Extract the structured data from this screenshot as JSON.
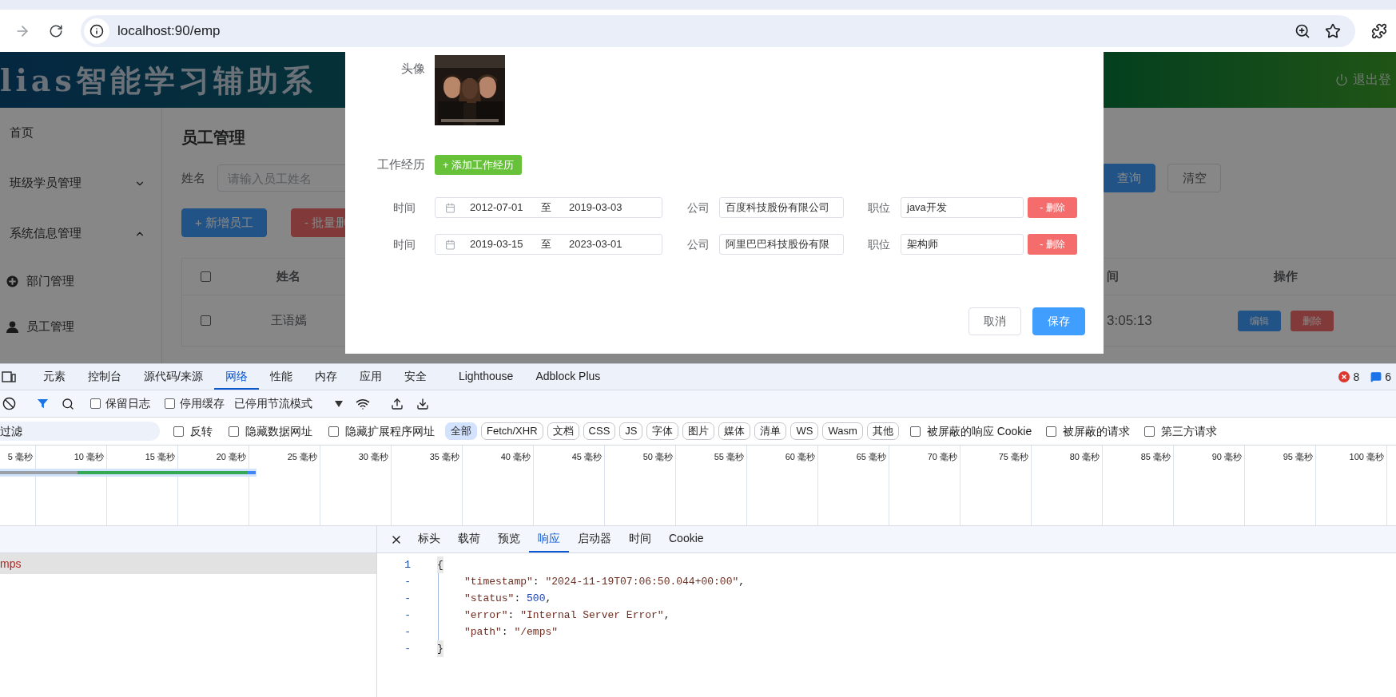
{
  "browser": {
    "url": "localhost:90/emp"
  },
  "app": {
    "header": {
      "title": "lias智能学习辅助系",
      "logout": "退出登"
    },
    "sidebar": {
      "items": [
        {
          "label": "首页",
          "kind": "link"
        },
        {
          "label": "班级学员管理",
          "kind": "group",
          "expanded": false
        },
        {
          "label": "系统信息管理",
          "kind": "group",
          "expanded": true,
          "children": [
            {
              "label": "部门管理"
            },
            {
              "label": "员工管理"
            }
          ]
        }
      ]
    },
    "main": {
      "title": "员工管理",
      "search": {
        "label": "姓名",
        "placeholder": "请输入员工姓名"
      },
      "form_buttons": [
        {
          "label": "查询",
          "kind": "primary"
        },
        {
          "label": "清空",
          "kind": "plain"
        }
      ],
      "actions": [
        {
          "label": "+ 新增员工",
          "kind": "primary"
        },
        {
          "label": "- 批量删",
          "kind": "danger"
        }
      ],
      "table": {
        "select_all": {
          "checked": false
        },
        "columns": [
          "姓名",
          "间",
          "操作"
        ],
        "rows": [
          {
            "checked": false,
            "name": "王语嫣",
            "time": "3:05:13",
            "actions": [
              {
                "label": "编辑",
                "kind": "primary"
              },
              {
                "label": "删除",
                "kind": "danger"
              }
            ]
          }
        ]
      }
    }
  },
  "dialog": {
    "avatar_label": "头像",
    "experience_label": "工作经历",
    "add_button": "+ 添加工作经历",
    "experiences": [
      {
        "time_label": "时间",
        "start": "2012-07-01",
        "separator": "至",
        "end": "2019-03-03",
        "company_label": "公司",
        "company": "百度科技股份有限公司",
        "position_label": "职位",
        "position": "java开发",
        "delete": "- 删除"
      },
      {
        "time_label": "时间",
        "start": "2019-03-15",
        "separator": "至",
        "end": "2023-03-01",
        "company_label": "公司",
        "company": "阿里巴巴科技股份有限",
        "position_label": "职位",
        "position": "架构师",
        "delete": "- 删除"
      }
    ],
    "buttons": [
      {
        "label": "取消",
        "kind": "plain"
      },
      {
        "label": "保存",
        "kind": "primary"
      }
    ]
  },
  "devtools": {
    "tabs": [
      {
        "label": "元素",
        "selected": false
      },
      {
        "label": "控制台",
        "selected": false
      },
      {
        "label": "源代码/来源",
        "selected": false
      },
      {
        "label": "网络",
        "selected": true
      },
      {
        "label": "性能",
        "selected": false
      },
      {
        "label": "内存",
        "selected": false
      },
      {
        "label": "应用",
        "selected": false
      },
      {
        "label": "安全",
        "selected": false
      },
      {
        "label": "Lighthouse",
        "selected": false
      },
      {
        "label": "Adblock Plus",
        "selected": false
      }
    ],
    "errors": "8",
    "messages": "6",
    "toolbar": {
      "checkboxes": [
        {
          "label": "保留日志",
          "checked": false
        },
        {
          "label": "停用缓存",
          "checked": false
        }
      ],
      "throttling": "已停用节流模式"
    },
    "filter": {
      "placeholder": "过滤",
      "options": [
        {
          "label": "反转",
          "checked": false
        },
        {
          "label": "隐藏数据网址",
          "checked": false
        },
        {
          "label": "隐藏扩展程序网址",
          "checked": false
        }
      ],
      "types": [
        {
          "label": "全部",
          "selected": true
        },
        {
          "label": "Fetch/XHR",
          "selected": false
        },
        {
          "label": "文档",
          "selected": false
        },
        {
          "label": "CSS",
          "selected": false
        },
        {
          "label": "JS",
          "selected": false
        },
        {
          "label": "字体",
          "selected": false
        },
        {
          "label": "图片",
          "selected": false
        },
        {
          "label": "媒体",
          "selected": false
        },
        {
          "label": "清单",
          "selected": false
        },
        {
          "label": "WS",
          "selected": false
        },
        {
          "label": "Wasm",
          "selected": false
        },
        {
          "label": "其他",
          "selected": false
        }
      ],
      "more_options": [
        {
          "label": "被屏蔽的响应 Cookie",
          "checked": false
        },
        {
          "label": "被屏蔽的请求",
          "checked": false
        },
        {
          "label": "第三方请求",
          "checked": false
        }
      ]
    },
    "overview_ticks": [
      "5 毫秒",
      "10 毫秒",
      "15 毫秒",
      "20 毫秒",
      "25 毫秒",
      "30 毫秒",
      "35 毫秒",
      "40 毫秒",
      "45 毫秒",
      "50 毫秒",
      "55 毫秒",
      "60 毫秒",
      "65 毫秒",
      "70 毫秒",
      "75 毫秒",
      "80 毫秒",
      "85 毫秒",
      "90 毫秒",
      "95 毫秒",
      "100 毫秒"
    ],
    "requests": [
      {
        "name": "mps",
        "selected": true,
        "failed": true
      }
    ],
    "detail_tabs": [
      {
        "label": "标头",
        "selected": false
      },
      {
        "label": "载荷",
        "selected": false
      },
      {
        "label": "预览",
        "selected": false
      },
      {
        "label": "响应",
        "selected": true
      },
      {
        "label": "启动器",
        "selected": false
      },
      {
        "label": "时间",
        "selected": false
      },
      {
        "label": "Cookie",
        "selected": false
      }
    ],
    "response": {
      "open": {
        "gutter": "1",
        "text": "{"
      },
      "members": [
        {
          "gutter": "-",
          "tokens": [
            {
              "kind": "key",
              "text": "\"timestamp\""
            },
            {
              "kind": "punct",
              "text": ": "
            },
            {
              "kind": "string",
              "text": "\"2024-11-19T07:06:50.044+00:00\""
            },
            {
              "kind": "punct",
              "text": ","
            }
          ]
        },
        {
          "gutter": "-",
          "tokens": [
            {
              "kind": "key",
              "text": "\"status\""
            },
            {
              "kind": "punct",
              "text": ": "
            },
            {
              "kind": "number",
              "text": "500"
            },
            {
              "kind": "punct",
              "text": ","
            }
          ]
        },
        {
          "gutter": "-",
          "tokens": [
            {
              "kind": "key",
              "text": "\"error\""
            },
            {
              "kind": "punct",
              "text": ": "
            },
            {
              "kind": "string",
              "text": "\"Internal Server Error\""
            },
            {
              "kind": "punct",
              "text": ","
            }
          ]
        },
        {
          "gutter": "-",
          "tokens": [
            {
              "kind": "key",
              "text": "\"path\""
            },
            {
              "kind": "punct",
              "text": ": "
            },
            {
              "kind": "string",
              "text": "\"/emps\""
            }
          ]
        }
      ],
      "close": {
        "gutter": "-",
        "text": "}"
      }
    }
  }
}
